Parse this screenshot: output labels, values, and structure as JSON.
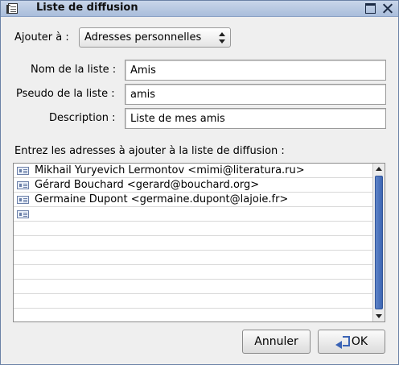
{
  "window": {
    "title": "Liste de diffusion"
  },
  "form": {
    "add_to_label": "Ajouter à :",
    "add_to_value": "Adresses personnelles",
    "list_name_label": "Nom de la liste :",
    "list_name_value": "Amis",
    "alias_label": "Pseudo de la liste :",
    "alias_value": "amis",
    "description_label": "Description :",
    "description_value": "Liste de mes amis"
  },
  "addresses": {
    "heading": "Entrez les adresses à ajouter à la liste de diffusion :",
    "rows": [
      "Mikhail Yuryevich Lermontov <mimi@literatura.ru>",
      "Gérard Bouchard <gerard@bouchard.org>",
      "Germaine Dupont <germaine.dupont@lajoie.fr>",
      ""
    ]
  },
  "buttons": {
    "cancel": "Annuler",
    "ok": "OK"
  }
}
